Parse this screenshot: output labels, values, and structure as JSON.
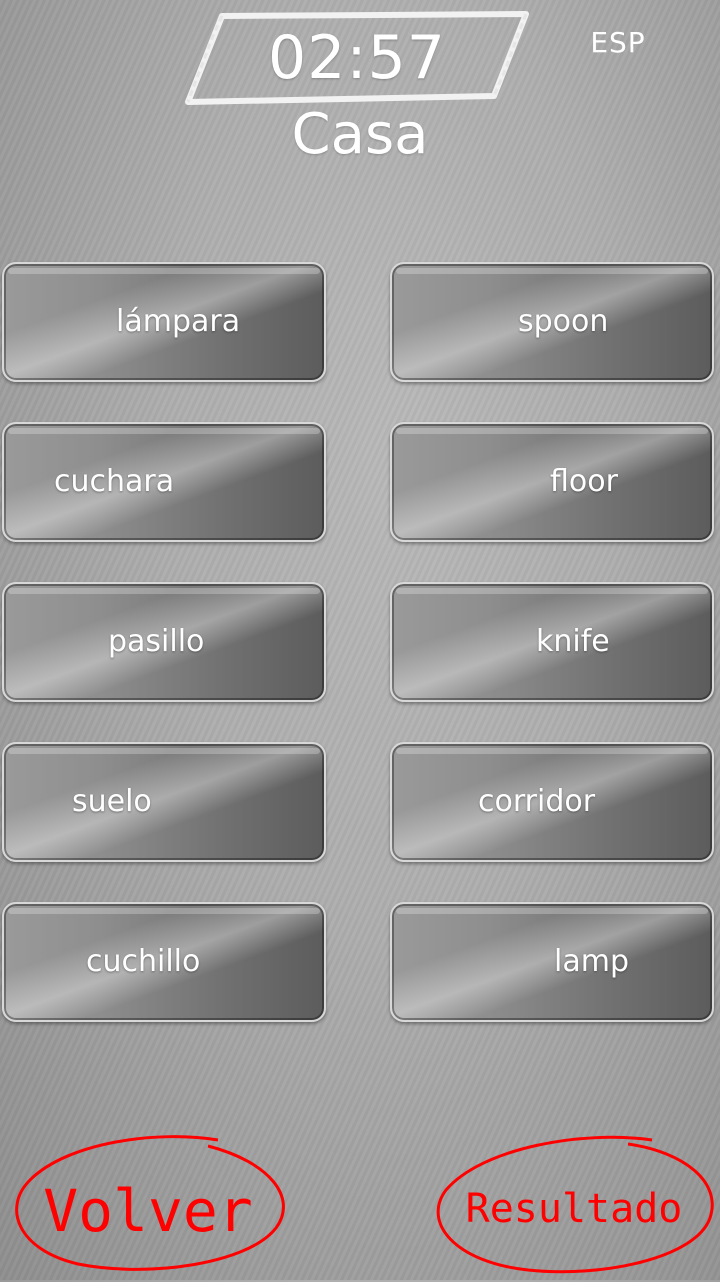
{
  "header": {
    "timer": "02:57",
    "language": "ESP",
    "category": "Casa"
  },
  "tiles": {
    "left": [
      "lámpara",
      "cuchara",
      "pasillo",
      "suelo",
      "cuchillo"
    ],
    "right": [
      "spoon",
      "floor",
      "knife",
      "corridor",
      "lamp"
    ]
  },
  "footer": {
    "back_label": "Volver",
    "result_label": "Resultado"
  },
  "colors": {
    "accent_red": "#ff0000",
    "text_white": "#ffffff"
  }
}
